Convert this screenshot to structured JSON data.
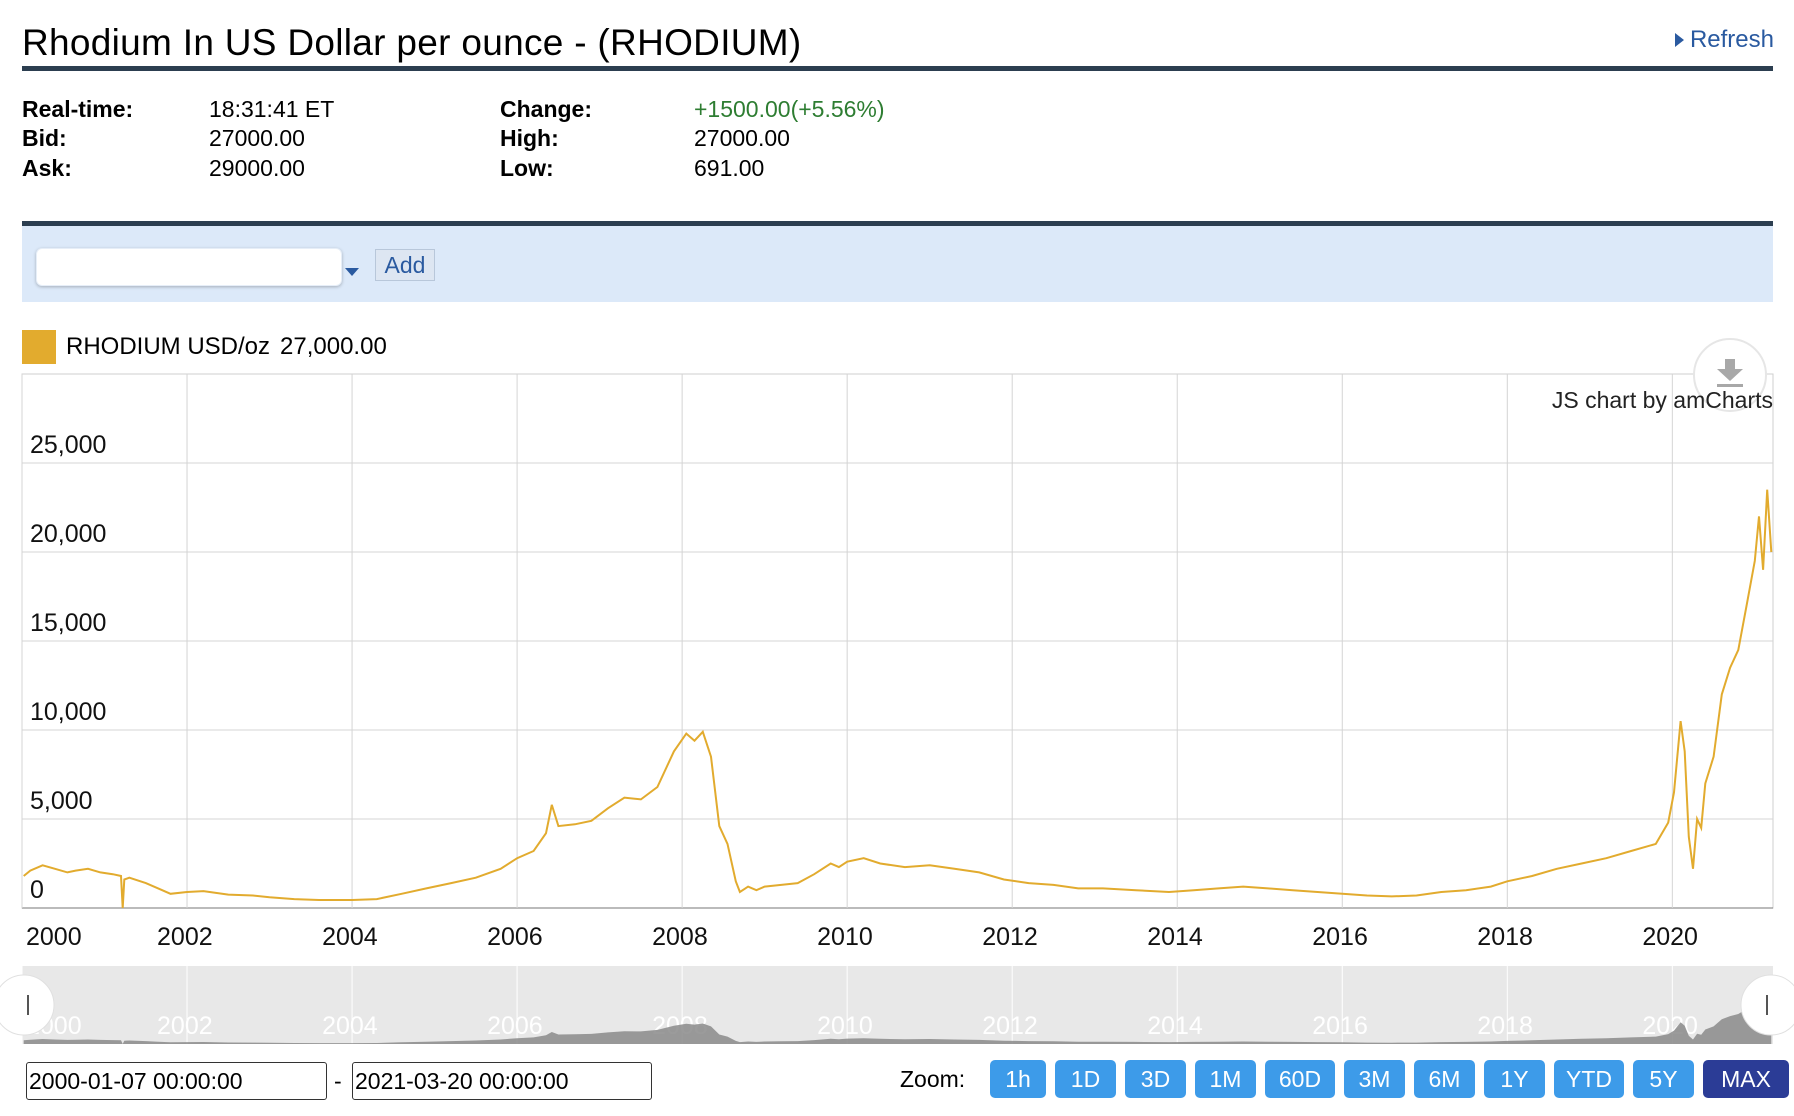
{
  "header": {
    "title": "Rhodium In US Dollar per ounce - (RHODIUM)",
    "refresh_label": "Refresh"
  },
  "quote": {
    "realtime_label": "Real-time:",
    "realtime_value": "18:31:41 ET",
    "bid_label": "Bid:",
    "bid_value": "27000.00",
    "ask_label": "Ask:",
    "ask_value": "29000.00",
    "change_label": "Change:",
    "change_value": "+1500.00(+5.56%)",
    "high_label": "High:",
    "high_value": "27000.00",
    "low_label": "Low:",
    "low_value": "691.00",
    "change_color": "#2e7d32"
  },
  "toolbar": {
    "symbol_input_value": "",
    "add_label": "Add"
  },
  "legend": {
    "series_label": "RHODIUM USD/oz",
    "series_value": "27,000.00",
    "color": "#e2ab2e"
  },
  "credit": "JS chart by amCharts",
  "icons": {
    "export": "download-icon",
    "refresh": "triangle-right-icon"
  },
  "range": {
    "start": "2000-01-07 00:00:00",
    "end": "2021-03-20 00:00:00",
    "separator": "-"
  },
  "zoom": {
    "label": "Zoom:",
    "buttons": [
      "1h",
      "1D",
      "3D",
      "1M",
      "60D",
      "3M",
      "6M",
      "1Y",
      "YTD",
      "5Y",
      "MAX"
    ],
    "active": "MAX",
    "button_color": "#3d9be9",
    "active_color": "#2b3c96"
  },
  "chart_data": {
    "type": "line",
    "title": "",
    "xlabel": "",
    "ylabel": "",
    "ylim": [
      0,
      30000
    ],
    "xlim": [
      2000.0,
      2021.22
    ],
    "y_ticks": [
      0,
      5000,
      10000,
      15000,
      20000,
      25000
    ],
    "y_tick_labels": [
      "0",
      "5,000",
      "10,000",
      "15,000",
      "20,000",
      "25,000"
    ],
    "x_ticks": [
      2000,
      2002,
      2004,
      2006,
      2008,
      2010,
      2012,
      2014,
      2016,
      2018,
      2020
    ],
    "x_tick_labels": [
      "2000",
      "2002",
      "2004",
      "2006",
      "2008",
      "2010",
      "2012",
      "2014",
      "2016",
      "2018",
      "2020"
    ],
    "grid": true,
    "legend": "top-left",
    "series": [
      {
        "name": "RHODIUM USD/oz",
        "color": "#e2ab2e",
        "x": [
          2000.02,
          2000.1,
          2000.25,
          2000.4,
          2000.55,
          2000.65,
          2000.8,
          2000.95,
          2001.1,
          2001.2,
          2001.22,
          2001.24,
          2001.3,
          2001.5,
          2001.65,
          2001.8,
          2002.0,
          2002.2,
          2002.5,
          2002.8,
          2003.0,
          2003.3,
          2003.6,
          2004.0,
          2004.3,
          2004.6,
          2004.9,
          2005.2,
          2005.5,
          2005.8,
          2006.0,
          2006.2,
          2006.35,
          2006.42,
          2006.5,
          2006.7,
          2006.9,
          2007.1,
          2007.3,
          2007.5,
          2007.7,
          2007.9,
          2008.05,
          2008.15,
          2008.25,
          2008.35,
          2008.45,
          2008.55,
          2008.65,
          2008.7,
          2008.8,
          2008.9,
          2009.0,
          2009.2,
          2009.4,
          2009.6,
          2009.8,
          2009.9,
          2010.0,
          2010.2,
          2010.4,
          2010.7,
          2011.0,
          2011.3,
          2011.6,
          2011.9,
          2012.2,
          2012.5,
          2012.8,
          2013.1,
          2013.5,
          2013.9,
          2014.2,
          2014.5,
          2014.8,
          2015.1,
          2015.4,
          2015.7,
          2016.0,
          2016.3,
          2016.6,
          2016.9,
          2017.2,
          2017.5,
          2017.8,
          2018.0,
          2018.3,
          2018.6,
          2018.9,
          2019.2,
          2019.5,
          2019.8,
          2019.95,
          2020.02,
          2020.1,
          2020.15,
          2020.2,
          2020.25,
          2020.3,
          2020.35,
          2020.4,
          2020.5,
          2020.6,
          2020.7,
          2020.8,
          2020.9,
          2021.0,
          2021.05,
          2021.1,
          2021.15,
          2021.2
        ],
        "y": [
          1800,
          2100,
          2400,
          2200,
          2000,
          2100,
          2200,
          2000,
          1900,
          1800,
          0,
          1600,
          1700,
          1400,
          1100,
          800,
          900,
          950,
          750,
          700,
          600,
          500,
          450,
          450,
          500,
          800,
          1100,
          1400,
          1700,
          2200,
          2800,
          3200,
          4200,
          5800,
          4600,
          4700,
          4900,
          5600,
          6200,
          6100,
          6800,
          8800,
          9800,
          9400,
          9900,
          8500,
          4600,
          3600,
          1500,
          900,
          1200,
          1000,
          1200,
          1300,
          1400,
          1900,
          2500,
          2300,
          2600,
          2800,
          2500,
          2300,
          2400,
          2200,
          2000,
          1600,
          1400,
          1300,
          1100,
          1100,
          1000,
          900,
          1000,
          1100,
          1200,
          1100,
          1000,
          900,
          800,
          700,
          650,
          700,
          900,
          1000,
          1200,
          1500,
          1800,
          2200,
          2500,
          2800,
          3200,
          3600,
          4800,
          6500,
          10500,
          8800,
          4000,
          2200,
          5000,
          4500,
          7000,
          8500,
          12000,
          13500,
          14500,
          17000,
          19500,
          22000,
          19000,
          23500,
          20000
        ]
      }
    ]
  }
}
